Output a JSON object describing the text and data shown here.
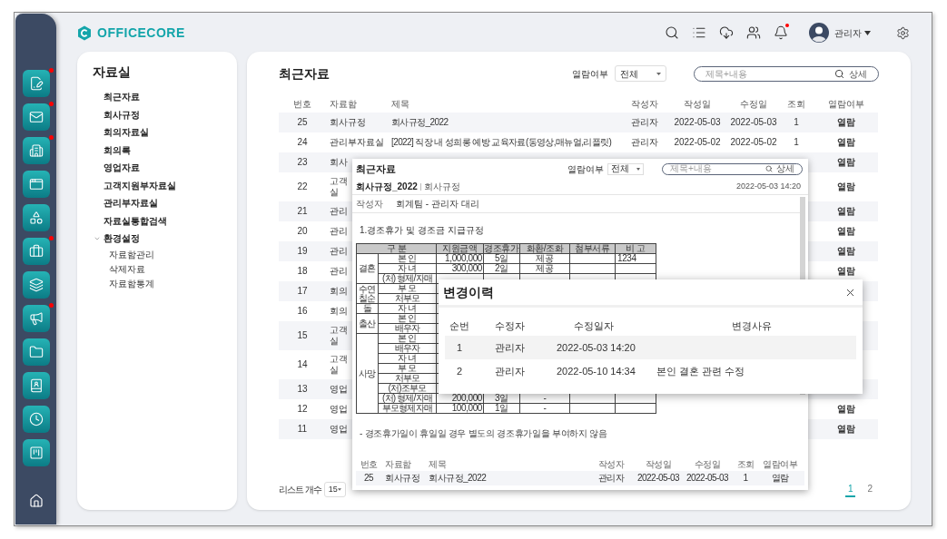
{
  "logo": "OFFICECORE",
  "header": {
    "user": "관리자",
    "notification": true
  },
  "rail": [
    {
      "notification": true
    },
    {
      "notification": true
    },
    {
      "notification": true
    },
    {
      "notification": false
    },
    {
      "notification": false
    },
    {
      "notification": true
    },
    {
      "notification": false
    },
    {
      "notification": true
    },
    {
      "notification": false
    },
    {
      "notification": false
    },
    {
      "notification": false
    },
    {
      "notification": false
    }
  ],
  "sidebar": {
    "title": "자료실",
    "items": [
      {
        "label": "최근자료"
      },
      {
        "label": "회사규정"
      },
      {
        "label": "회의자료실"
      },
      {
        "label": "회의록"
      },
      {
        "label": "영업자료"
      },
      {
        "label": "고객지원부자료실"
      },
      {
        "label": "관리부자료실"
      },
      {
        "label": "자료실통합검색"
      },
      {
        "label": "환경설정",
        "expanded": true,
        "children": [
          {
            "label": "자료함관리"
          },
          {
            "label": "삭제자료"
          },
          {
            "label": "자료함통계"
          }
        ]
      }
    ]
  },
  "main": {
    "title": "최근자료",
    "filter": {
      "label": "열람여부",
      "value": "전체"
    },
    "search": {
      "placeholder": "제목+내용",
      "button": "상세"
    },
    "columns": [
      "번호",
      "자료함",
      "제목",
      "작성자",
      "작성일",
      "수정일",
      "조회",
      "열람여부"
    ],
    "rows": [
      {
        "no": "25",
        "category": "회사규정",
        "title": "회사규정_2022",
        "author": "관리자",
        "created": "2022-05-03",
        "modified": "2022-05-03",
        "views": "1",
        "access": "열람"
      },
      {
        "no": "24",
        "category": "관리부자료실",
        "title": "[2022] 직장 내 성희롱 예방 교육자료(동영상,매뉴얼,리플릿)",
        "author": "관리자",
        "created": "2022-05-02",
        "modified": "2022-05-02",
        "views": "1",
        "access": "열람"
      },
      {
        "no": "23",
        "category": "회사",
        "access": "열람"
      },
      {
        "no": "22",
        "category": "고객\n실",
        "access": "열람"
      },
      {
        "no": "21",
        "category": "관리",
        "access": "열람"
      },
      {
        "no": "20",
        "category": "관리",
        "access": "열람"
      },
      {
        "no": "19",
        "category": "관리",
        "access": "열람"
      },
      {
        "no": "18",
        "category": "관리",
        "access": "열람"
      },
      {
        "no": "17",
        "category": "회의"
      },
      {
        "no": "16",
        "category": "회의"
      },
      {
        "no": "15",
        "category": "고객\n실"
      },
      {
        "no": "14",
        "category": "고객\n실"
      },
      {
        "no": "13",
        "category": "영업"
      },
      {
        "no": "12",
        "category": "영업",
        "access": "열람"
      },
      {
        "no": "11",
        "category": "영업",
        "access": "열람"
      }
    ],
    "footer": {
      "page_size_label": "리스트 개수",
      "page_size": "15",
      "pages": [
        {
          "label": "1",
          "selected": true
        },
        {
          "label": "2",
          "selected": false
        }
      ]
    }
  },
  "preview": {
    "title": "최근자료",
    "filter_label": "열람여부",
    "filter_value": "전체",
    "search_placeholder": "제목+내용",
    "search_button": "상세",
    "doc_title": "회사규정_2022",
    "doc_category": "회사규정",
    "doc_date": "2022-05-03 14:20",
    "author_label": "작성자",
    "author": "회계팀 - 관리자 대리",
    "heading": "1.경조휴가 및 경조금 지급규정",
    "table": {
      "columns": [
        "구 분",
        "지원금액",
        "경조휴가",
        "화환/조화",
        "첨부서류",
        "비 고"
      ],
      "groups": [
        {
          "label": "결혼",
          "rows": [
            {
              "item": "본 인",
              "amount": "1,000,000",
              "leave": "5일",
              "flowers": "제공",
              "note": "1234"
            },
            {
              "item": "자 녀",
              "amount": "300,000",
              "leave": "2일",
              "flowers": "제공"
            },
            {
              "item": "(처) 형제/자매"
            }
          ]
        },
        {
          "label": "수연\n칠순",
          "rows": [
            {
              "item": "부 모"
            },
            {
              "item": "처부모"
            }
          ]
        },
        {
          "label": "돌",
          "rows": [
            {
              "item": "자 녀"
            }
          ]
        },
        {
          "label": "출산",
          "rows": [
            {
              "item": "본 인"
            },
            {
              "item": "배우자"
            }
          ]
        },
        {
          "label": "사망",
          "rows": [
            {
              "item": "본 인"
            },
            {
              "item": "배우자"
            },
            {
              "item": "자 녀"
            },
            {
              "item": "부 모"
            },
            {
              "item": "처부모"
            },
            {
              "item": "(처)조부모"
            },
            {
              "item": "(처) 형제/자매",
              "amount": "200,000",
              "leave": "3일",
              "flowers": "-"
            },
            {
              "item": "부모형제자매",
              "amount": "100,000",
              "leave": "1일",
              "flowers": "-"
            }
          ]
        }
      ]
    },
    "footnote": "- 경조휴가일이 휴일일 경우 별도의 경조휴가일을 부여하지 않음",
    "list": {
      "columns": [
        "번호",
        "자료함",
        "제목",
        "작성자",
        "작성일",
        "수정일",
        "조회",
        "열람여부"
      ],
      "rows": [
        {
          "no": "25",
          "category": "회사규정",
          "title": "회사규정_2022",
          "author": "관리자",
          "created": "2022-05-03",
          "modified": "2022-05-03",
          "views": "1",
          "access": "열람"
        }
      ]
    }
  },
  "modal": {
    "title": "변경이력",
    "columns": [
      "순번",
      "수정자",
      "수정일자",
      "변경사유"
    ],
    "rows": [
      {
        "no": "1",
        "editor": "관리자",
        "date": "2022-05-03 14:20"
      },
      {
        "no": "2",
        "editor": "관리자",
        "date": "2022-05-10 14:34",
        "reason": "본인 결혼 관련 수정"
      }
    ]
  }
}
